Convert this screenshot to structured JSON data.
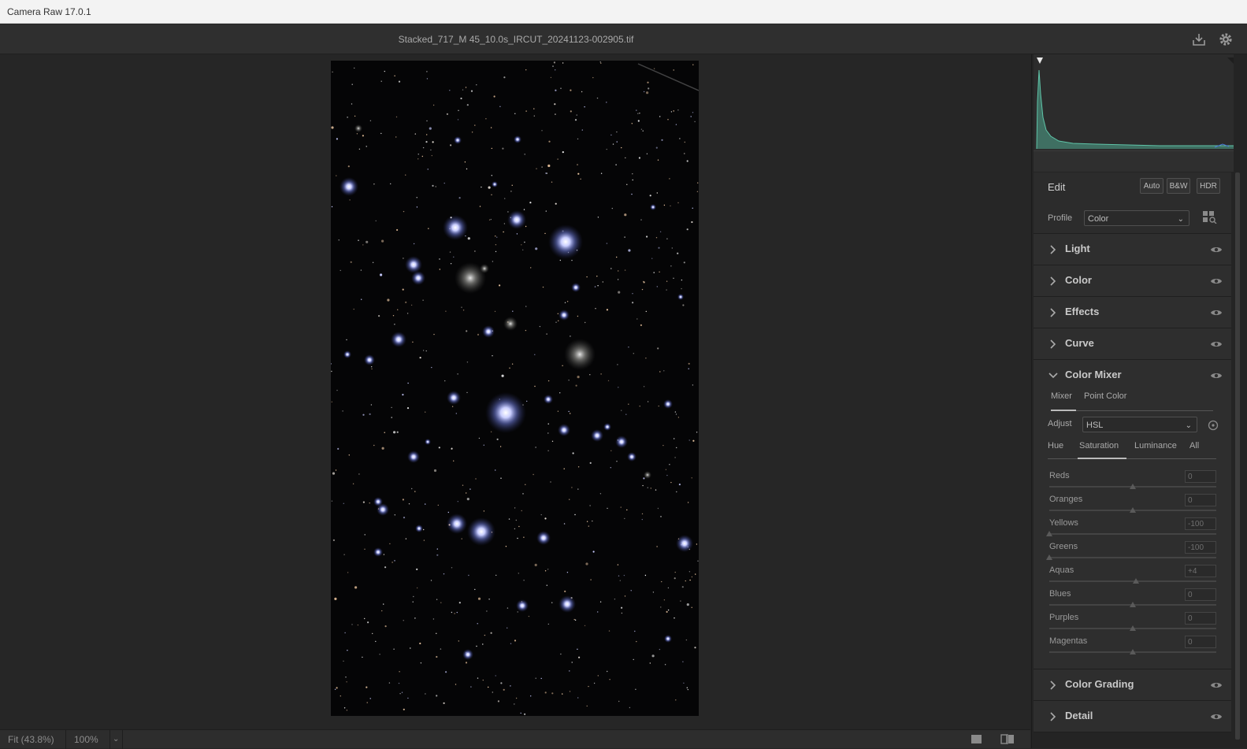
{
  "window": {
    "title": "Camera Raw 17.0.1"
  },
  "header": {
    "filename": "Stacked_717_M 45_10.0s_IRCUT_20241123-002905.tif",
    "icons": [
      "save-icon",
      "gear-icon"
    ]
  },
  "footer": {
    "fit_label": "Fit (43.8%)",
    "zoom_label": "100%",
    "icons": [
      "chevron-down-icon",
      "single-view-icon",
      "compare-view-icon"
    ]
  },
  "edit": {
    "title": "Edit",
    "buttons": {
      "auto": "Auto",
      "bw": "B&W",
      "hdr": "HDR"
    },
    "profile_label": "Profile",
    "profile_value": "Color"
  },
  "sections": {
    "light": "Light",
    "color": "Color",
    "effects": "Effects",
    "curve": "Curve",
    "color_mixer": "Color Mixer",
    "color_grading": "Color Grading",
    "detail": "Detail"
  },
  "mixer": {
    "tabs": [
      "Mixer",
      "Point Color"
    ],
    "adjust_label": "Adjust",
    "adjust_value": "HSL",
    "subtabs": [
      "Hue",
      "Saturation",
      "Luminance",
      "All"
    ],
    "sliders": [
      {
        "label": "Reds",
        "value": "0",
        "num": 0
      },
      {
        "label": "Oranges",
        "value": "0",
        "num": 0
      },
      {
        "label": "Yellows",
        "value": "-100",
        "num": -100
      },
      {
        "label": "Greens",
        "value": "-100",
        "num": -100
      },
      {
        "label": "Aquas",
        "value": "+4",
        "num": 4
      },
      {
        "label": "Blues",
        "value": "0",
        "num": 0
      },
      {
        "label": "Purples",
        "value": "0",
        "num": 0
      },
      {
        "label": "Magentas",
        "value": "0",
        "num": 0
      }
    ]
  },
  "colors": {
    "accent": "#3aa3a3",
    "star_blue": "#aab4ff"
  }
}
